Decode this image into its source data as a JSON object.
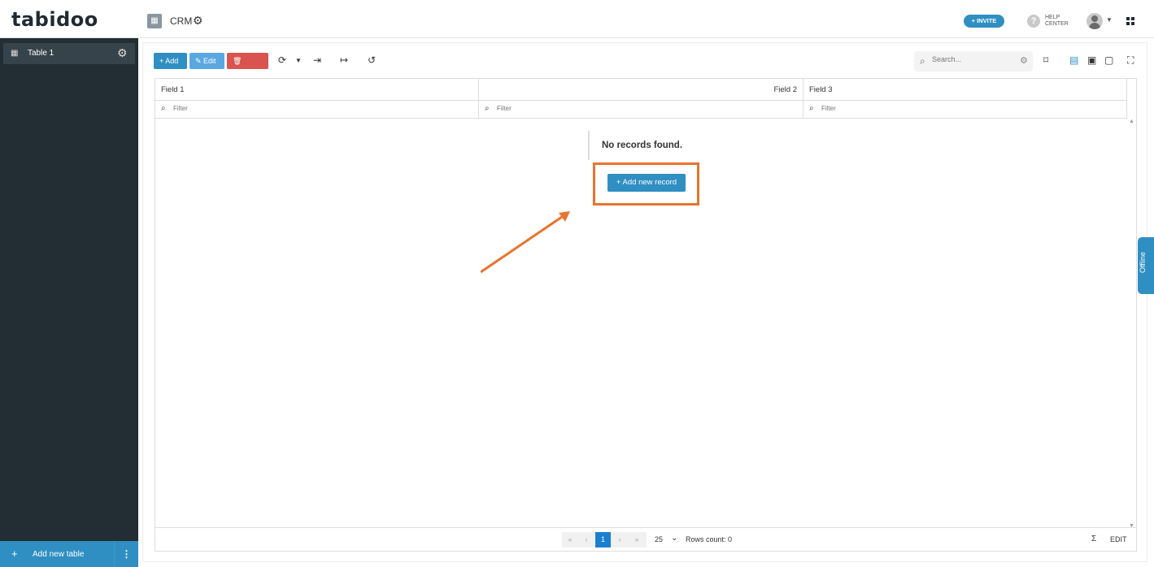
{
  "header": {
    "logo": "tabidoo",
    "app_title": "CRM",
    "invite_label": "+ INVITE",
    "help_line1": "HELP",
    "help_line2": "CENTER"
  },
  "sidebar": {
    "items": [
      {
        "label": "Table 1"
      }
    ],
    "add_table_label": "Add new table"
  },
  "toolbar": {
    "add_label": "+ Add",
    "edit_label": "Edit",
    "delete_label": "Delete",
    "search_placeholder": "Search..."
  },
  "grid": {
    "columns": [
      "Field 1",
      "Field 2",
      "Field 3"
    ],
    "filter_placeholder": "Filter",
    "empty_message": "No records found.",
    "add_record_label": "+ Add new record"
  },
  "footer": {
    "current_page": "1",
    "page_size": "25",
    "rows_count": "Rows count: 0",
    "sigma": "Σ",
    "edit_label": "EDIT"
  },
  "offline_label": "Offline",
  "colors": {
    "primary": "#2f8fc2",
    "danger": "#d9534f",
    "highlight": "#e8742f",
    "sidebar_bg": "#232e34"
  }
}
